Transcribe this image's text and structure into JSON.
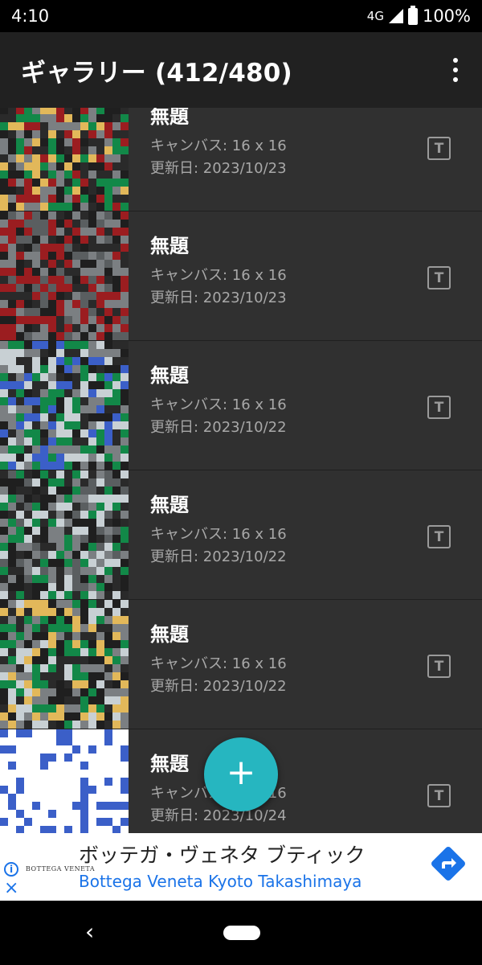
{
  "status_bar": {
    "time": "4:10",
    "network": "4G",
    "battery": "100%"
  },
  "app_bar": {
    "title": "ギャラリー (412/480)"
  },
  "gallery": {
    "items": [
      {
        "title": "無題",
        "canvas": "キャンバス: 16 x 16",
        "updated": "更新日: 2023/10/23",
        "badge": "T"
      },
      {
        "title": "無題",
        "canvas": "キャンバス: 16 x 16",
        "updated": "更新日: 2023/10/23",
        "badge": "T"
      },
      {
        "title": "無題",
        "canvas": "キャンバス: 16 x 16",
        "updated": "更新日: 2023/10/22",
        "badge": "T"
      },
      {
        "title": "無題",
        "canvas": "キャンバス: 16 x 16",
        "updated": "更新日: 2023/10/22",
        "badge": "T"
      },
      {
        "title": "無題",
        "canvas": "キャンバス: 16 x 16",
        "updated": "更新日: 2023/10/22",
        "badge": "T"
      },
      {
        "title": "無題",
        "canvas": "キャンバス: 16 x 16",
        "updated": "更新日: 2023/10/24",
        "badge": "T"
      }
    ]
  },
  "fab": {
    "label": "+"
  },
  "ad": {
    "logo": "BOTTEGA VENETA",
    "headline": "ボッテガ・ヴェネタ ブティック",
    "subline": "Bottega Veneta Kyoto Takashimaya",
    "info_icon": "i",
    "close_icon": "×",
    "accent": "#1a73e8"
  },
  "nav": {
    "back": "‹"
  },
  "colors": {
    "fab": "#26b6c0",
    "app_bar": "#212121",
    "list_bg": "#303030"
  }
}
